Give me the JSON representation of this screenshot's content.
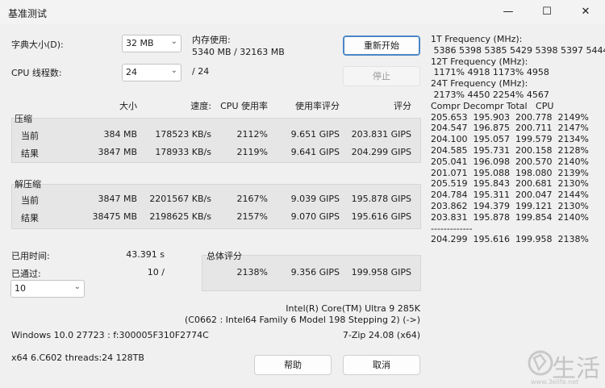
{
  "window": {
    "title": "基准测试",
    "minimize": "—",
    "maximize": "☐",
    "close": "✕"
  },
  "controls": {
    "dict_label": "字典大小(D):",
    "dict_value": "32 MB",
    "threads_label": "CPU 线程数:",
    "threads_value": "24",
    "threads_total": "/ 24",
    "mem_label": "内存使用:",
    "mem_value": "5340 MB / 32163 MB",
    "restart_button": "重新开始",
    "stop_button": "停止"
  },
  "headers": {
    "size": "大小",
    "speed": "速度:",
    "cpu": "CPU 使用率",
    "rating_usage": "使用率评分",
    "rating": "评分"
  },
  "compress": {
    "label": "压缩",
    "rows": [
      {
        "label": "当前",
        "size": "384 MB",
        "speed": "178523 KB/s",
        "cpu": "2112%",
        "rating_usage": "9.651 GIPS",
        "rating": "203.831 GIPS"
      },
      {
        "label": "结果",
        "size": "3847 MB",
        "speed": "178933 KB/s",
        "cpu": "2119%",
        "rating_usage": "9.641 GIPS",
        "rating": "204.299 GIPS"
      }
    ]
  },
  "decompress": {
    "label": "解压缩",
    "rows": [
      {
        "label": "当前",
        "size": "3847 MB",
        "speed": "2201567 KB/s",
        "cpu": "2167%",
        "rating_usage": "9.039 GIPS",
        "rating": "195.878 GIPS"
      },
      {
        "label": "结果",
        "size": "38475 MB",
        "speed": "2198625 KB/s",
        "cpu": "2157%",
        "rating_usage": "9.070 GIPS",
        "rating": "195.616 GIPS"
      }
    ]
  },
  "elapsed": {
    "label": "已用时间:",
    "value": "43.391 s"
  },
  "passed": {
    "label": "已通过:",
    "value": "10 /",
    "select": "10"
  },
  "total": {
    "label": "总体评分",
    "cpu": "2138%",
    "rating_usage": "9.356 GIPS",
    "rating": "199.958 GIPS"
  },
  "cpu_info": {
    "line1": "Intel(R) Core(TM) Ultra 9 285K",
    "line2": "(C0662 : Intel64 Family 6 Model 198 Stepping 2) (->)"
  },
  "sys": {
    "os": "Windows 10.0 27723 : f:300005F310F2774C",
    "version": "7-Zip 24.08 (x64)",
    "arch": "x64 6.C602 threads:24 128TB"
  },
  "buttons": {
    "help": "帮助",
    "cancel": "取消"
  },
  "freq_text": "1T Frequency (MHz):\n 5386 5398 5385 5429 5398 5397 5444\n12T Frequency (MHz):\n 1171% 4918 1173% 4958\n24T Frequency (MHz):\n 2173% 4450 2254% 4567\nCompr Decompr Total   CPU\n205.653  195.903  200.778  2149%\n204.547  196.875  200.711  2147%\n204.100  195.057  199.579  2134%\n204.585  195.731  200.158  2128%\n205.041  196.098  200.570  2140%\n201.071  195.088  198.080  2139%\n205.519  195.843  200.681  2130%\n204.784  195.311  200.047  2144%\n203.862  194.379  199.121  2130%\n203.831  195.878  199.854  2140%\n-------------\n204.299  195.616  199.958  2138%",
  "logo": {
    "text": "生活",
    "url": "www.3elife.net"
  }
}
